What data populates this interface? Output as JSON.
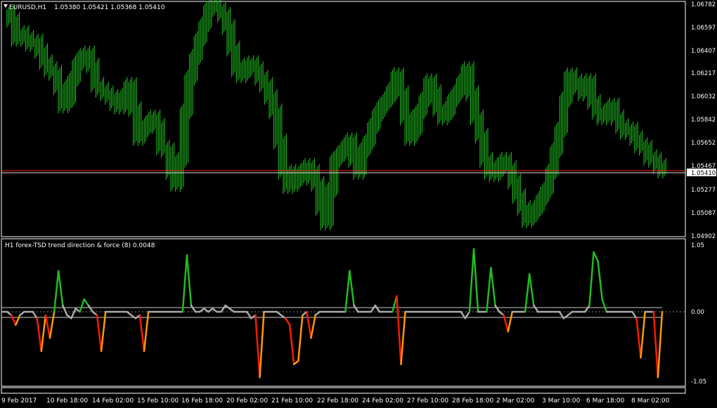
{
  "header": {
    "symbol_label": "EURUSD,H1",
    "ohlc_label": "1.05380 1.05421 1.05368 1.05410",
    "collapse_icon": "triangle-down-icon"
  },
  "indicator": {
    "label": "H1 forex-TSD trend direction & force (8) 0.0048",
    "levels": [
      "1.05",
      "0.00",
      "-1.05"
    ]
  },
  "price_axis": {
    "labels": [
      "1.06782",
      "1.06597",
      "1.06407",
      "1.06217",
      "1.06032",
      "1.05842",
      "1.05652",
      "1.05467",
      "1.05277",
      "1.05087",
      "1.04902"
    ],
    "current_price": "1.05410"
  },
  "time_axis": {
    "labels": [
      "9 Feb 2017",
      "10 Feb 18:00",
      "14 Feb 02:00",
      "15 Feb 10:00",
      "16 Feb 18:00",
      "20 Feb 02:00",
      "21 Feb 10:00",
      "22 Feb 18:00",
      "24 Feb 02:00",
      "27 Feb 10:00",
      "28 Feb 18:00",
      "2 Mar 02:00",
      "3 Mar 10:00",
      "6 Mar 18:00",
      "8 Mar 02:00"
    ]
  },
  "colors": {
    "background": "#000000",
    "candle": "#22cc22",
    "grid_border": "#ffffff",
    "price_line": "#ff2020",
    "tsd_up": "#22bb22",
    "tsd_down": "#ff1a00",
    "tsd_down_fade": "#ff9900",
    "tsd_neutral": "#aaaaaa"
  },
  "chart_data": [
    {
      "type": "line",
      "title": "EURUSD,H1",
      "ylim": [
        1.0488,
        1.068
      ],
      "series": [
        {
          "name": "EURUSD,H1",
          "values": [
            1.0672,
            1.0666,
            1.065,
            1.0655,
            1.0651,
            1.0646,
            1.0648,
            1.064,
            1.0631,
            1.0625,
            1.0622,
            1.061,
            1.0595,
            1.06,
            1.0617,
            1.063,
            1.0636,
            1.0638,
            1.0628,
            1.0612,
            1.0608,
            1.0605,
            1.0602,
            1.0597,
            1.0594,
            1.0603,
            1.0612,
            1.0592,
            1.0568,
            1.0575,
            1.058,
            1.0585,
            1.0578,
            1.056,
            1.0558,
            1.054,
            1.053,
            1.055,
            1.059,
            1.0618,
            1.0635,
            1.065,
            1.0662,
            1.0675,
            1.0678,
            1.0675,
            1.067,
            1.066,
            1.0642,
            1.0625,
            1.062,
            1.0628,
            1.063,
            1.0625,
            1.0618,
            1.0612,
            1.0602,
            1.059,
            1.0565,
            1.054,
            1.0528,
            1.053,
            1.054,
            1.0535,
            1.0545,
            1.054,
            1.053,
            1.051,
            1.0498,
            1.0525,
            1.055,
            1.0555,
            1.056,
            1.0566,
            1.055,
            1.054,
            1.0558,
            1.0565,
            1.0578,
            1.0588,
            1.0595,
            1.06,
            1.0608,
            1.062,
            1.0605,
            1.0585,
            1.0568,
            1.0575,
            1.059,
            1.06,
            1.0615,
            1.0606,
            1.0592,
            1.0585,
            1.059,
            1.06,
            1.0606,
            1.0615,
            1.0625,
            1.0605,
            1.0585,
            1.057,
            1.055,
            1.054,
            1.0538,
            1.0545,
            1.055,
            1.0543,
            1.0532,
            1.052,
            1.051,
            1.05,
            1.0505,
            1.051,
            1.0518,
            1.0525,
            1.054,
            1.0558,
            1.0575,
            1.06,
            1.062,
            1.0615,
            1.061,
            1.0605,
            1.0615,
            1.0598,
            1.059,
            1.0585,
            1.059,
            1.0595,
            1.0585,
            1.0578,
            1.0573,
            1.0575,
            1.0568,
            1.0562,
            1.056,
            1.0552,
            1.055,
            1.0545,
            1.0541
          ]
        }
      ]
    },
    {
      "type": "line",
      "title": "H1 forex-TSD trend direction & force (8) 0.0048",
      "ylim": [
        -1.05,
        1.05
      ],
      "series": [
        {
          "name": "forex-TSD",
          "values": [
            0.0,
            0.0,
            -0.05,
            -0.2,
            -0.05,
            0.0,
            0.0,
            0.0,
            -0.1,
            -0.6,
            -0.05,
            -0.4,
            0.0,
            0.65,
            0.1,
            -0.05,
            -0.1,
            0.05,
            0.0,
            0.2,
            0.1,
            0.0,
            -0.05,
            -0.6,
            0.0,
            0.0,
            0.0,
            0.0,
            0.0,
            0.0,
            -0.05,
            -0.1,
            -0.05,
            -0.6,
            0.0,
            0.0,
            0.0,
            0.0,
            0.0,
            0.0,
            0.0,
            0.0,
            0.0,
            0.9,
            0.1,
            0.0,
            0.0,
            0.05,
            0.0,
            0.05,
            0.0,
            0.0,
            0.1,
            0.05,
            0.0,
            0.0,
            0.0,
            0.0,
            -0.1,
            -0.05,
            -1.0,
            0.0,
            0.0,
            0.0,
            0.0,
            -0.05,
            -0.1,
            -0.2,
            -0.8,
            -0.75,
            -0.05,
            0.0,
            -0.4,
            -0.05,
            0.0,
            0.0,
            0.0,
            0.0,
            0.0,
            0.0,
            0.0,
            0.65,
            0.1,
            0.0,
            0.0,
            0.0,
            0.0,
            0.1,
            0.0,
            0.0,
            0.0,
            0.0,
            0.25,
            -0.8,
            0.0,
            0.0,
            0.0,
            0.0,
            0.0,
            0.0,
            0.0,
            0.0,
            0.0,
            0.0,
            0.0,
            0.0,
            0.0,
            0.0,
            -0.1,
            0.0,
            1.0,
            0.0,
            0.0,
            0.0,
            0.7,
            0.1,
            0.0,
            -0.05,
            -0.3,
            0.0,
            0.0,
            0.0,
            0.0,
            0.6,
            0.1,
            0.0,
            0.0,
            0.0,
            0.0,
            0.0,
            0.0,
            -0.1,
            -0.05,
            0.0,
            0.0,
            0.0,
            0.0,
            0.1,
            0.95,
            0.8,
            0.2,
            0.0,
            0.0,
            0.0,
            0.0,
            0.0,
            0.0,
            0.0,
            -0.1,
            -0.7,
            0.0,
            0.0,
            0.0,
            -1.0,
            0.0
          ]
        }
      ]
    }
  ]
}
